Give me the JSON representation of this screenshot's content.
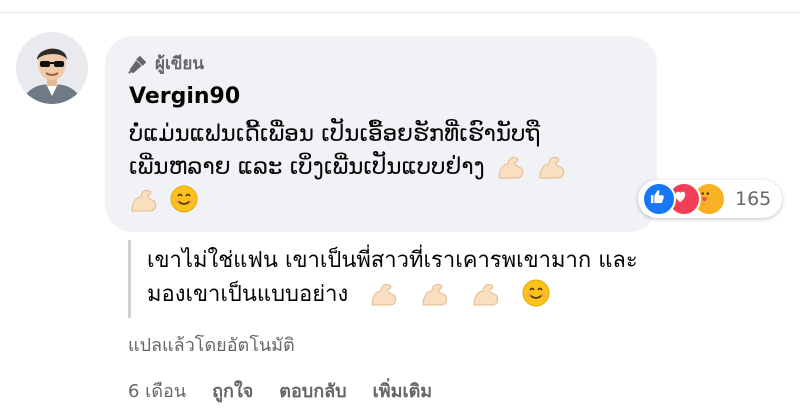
{
  "comment": {
    "author_badge": "ผู้เขียน",
    "commenter_name": "Vergin90",
    "text_line1": "ບໍ່ແມ່ນແຟນເດີ້ເພື່ອນ ເປັນເອື້ອຍຮັກທີ່ເຮົານັບຖື",
    "text_line2": "ເພີ່ນຫລາຍ ແລະ ເບິ່ງເພີ່ນເປັນແບບຢ່າງ",
    "reaction_count": "165"
  },
  "translation": {
    "line1": "เขาไม่ใช่แฟน เขาเป็นพี่สาวที่เราเคารพเขามาก และ",
    "line2": "มองเขาเป็นแบบอย่าง",
    "note": "แปลแล้วโดยอัตโนมัติ"
  },
  "actions": {
    "timestamp": "6 เดือน",
    "like": "ถูกใจ",
    "reply": "ตอบกลับ",
    "more": "เพิ่มเติม"
  },
  "icons": {
    "author_badge": "microphone-icon",
    "emoji_muscle": "flexed-biceps-emoji",
    "emoji_smile": "smiling-face-emoji",
    "reaction_like": "like-icon",
    "reaction_love": "love-icon",
    "reaction_care": "care-icon"
  },
  "colors": {
    "bubble_bg": "#f0f2f5",
    "like_blue": "#1877f2",
    "love_red": "#f33e58",
    "care_yellow": "#f7b125",
    "secondary_text": "#65676b"
  }
}
